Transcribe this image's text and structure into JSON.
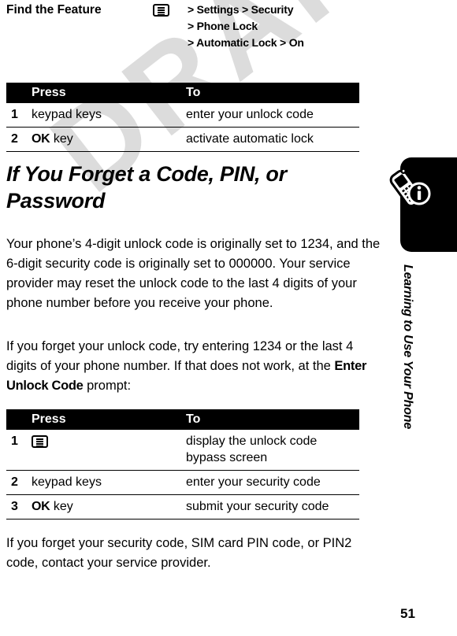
{
  "document": {
    "watermark": "DRAFT",
    "page_number": "51",
    "chapter_label": "Learning to Use Your Phone"
  },
  "find_feature": {
    "label": "Find the Feature",
    "key_icon": "menu-key-icon",
    "path_lines": [
      "> Settings > Security",
      "> Phone Lock",
      "> Automatic Lock > On"
    ]
  },
  "table_one": {
    "headers": {
      "num": "",
      "press": "Press",
      "to": "To"
    },
    "rows": [
      {
        "num": "1",
        "press": "keypad keys",
        "press_key": "",
        "to": "enter your unlock code"
      },
      {
        "num": "2",
        "press": "key",
        "press_key": "OK",
        "to": "activate automatic lock"
      }
    ]
  },
  "heading": "If You Forget a Code, PIN, or Password",
  "paragraph_one": "Your phone’s 4-digit unlock code is originally set to 1234, and the 6-digit security code is originally set to 000000. Your service provider may reset the unlock code to the last 4 digits of your phone number before you receive your phone.",
  "paragraph_two": {
    "before": "If you forget your unlock code, try entering 1234 or the last 4 digits of your phone number. If that does not work, at the ",
    "bold": "Enter Unlock Code",
    "after": " prompt:"
  },
  "table_two": {
    "headers": {
      "num": "",
      "press": "Press",
      "to": "To"
    },
    "rows": [
      {
        "num": "1",
        "press": "",
        "press_icon": "menu-key-icon",
        "to": "display the unlock code bypass screen"
      },
      {
        "num": "2",
        "press": "keypad keys",
        "press_key": "",
        "to": "enter your security code"
      },
      {
        "num": "3",
        "press": "key",
        "press_key": "OK",
        "to": "submit your security code"
      }
    ]
  },
  "paragraph_three": "If you forget your security code, SIM card PIN code, or PIN2 code, contact your service provider.",
  "colors": {
    "header_bar": "#000000",
    "header_text": "#ffffff",
    "body_text": "#000000",
    "watermark": "#dcdcdc",
    "rail_tab": "#000000"
  }
}
